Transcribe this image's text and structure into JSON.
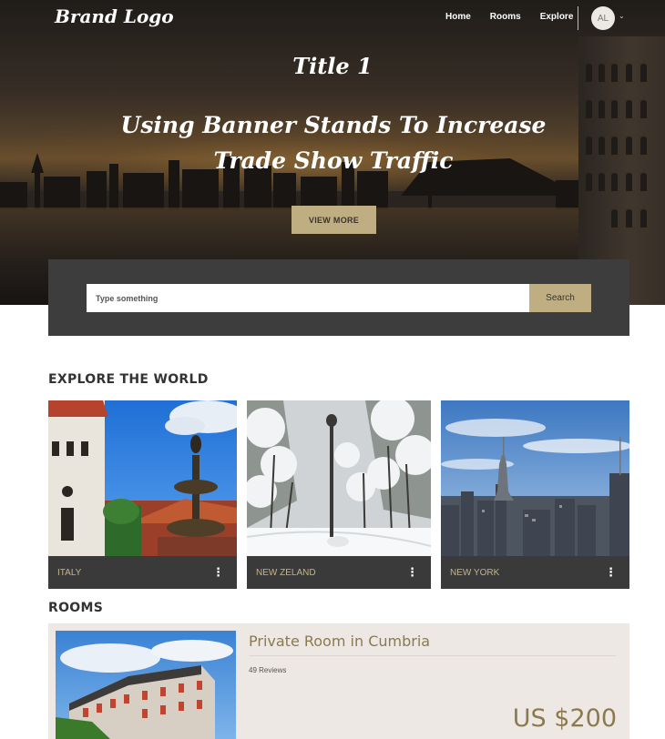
{
  "header": {
    "brand": "Brand Logo",
    "nav": [
      "Home",
      "Rooms",
      "Explore"
    ],
    "avatar_initials": "AL",
    "avatar_caret": "⌄"
  },
  "hero": {
    "title1": "Title 1",
    "title2": "Using Banner Stands To Increase Trade Show Traffic",
    "cta_label": "VIEW MORE"
  },
  "search": {
    "placeholder": "Type something",
    "button_label": "Search"
  },
  "explore": {
    "title": "EXPLORE THE WORLD",
    "cards": [
      {
        "label": "ITALY",
        "menu": "⋮"
      },
      {
        "label": "NEW ZELAND",
        "menu": "⋮"
      },
      {
        "label": "NEW YORK",
        "menu": "⋮"
      }
    ]
  },
  "rooms": {
    "title": "ROOMS",
    "items": [
      {
        "name": "Private Room in Cumbria",
        "reviews": "49 Reviews",
        "price": "US $200"
      }
    ]
  },
  "colors": {
    "accent": "#bfae82",
    "accent_text": "#8b7a4e",
    "panel": "#3d3d3d",
    "card_footer": "#3a3a3a",
    "room_bg": "#ede8e3"
  }
}
